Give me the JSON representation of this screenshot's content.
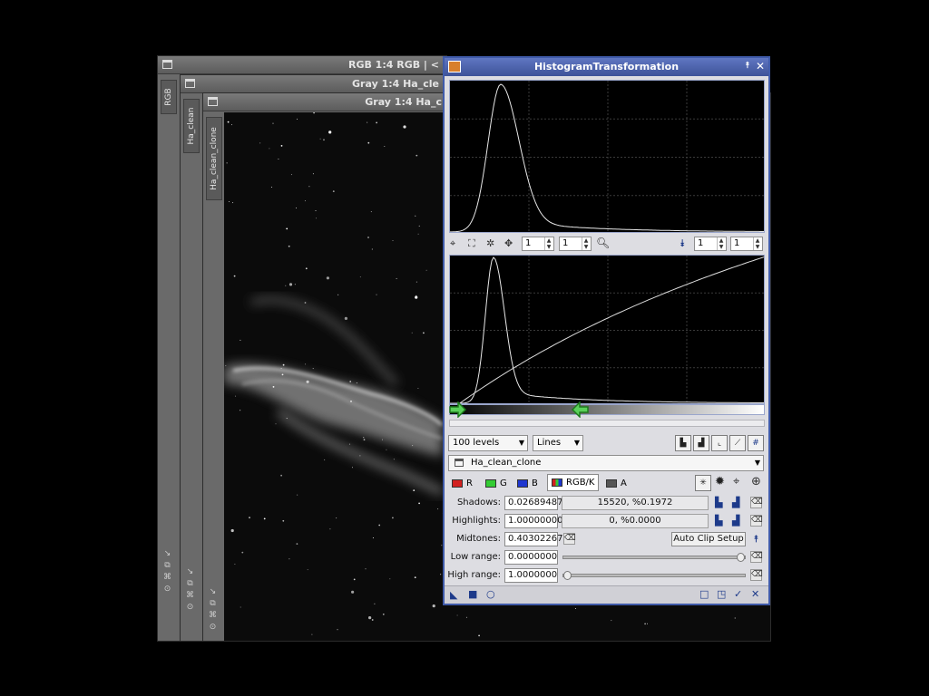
{
  "windows": [
    {
      "id": "rgb",
      "title": "RGB 1:4 RGB | <",
      "tab": "RGB"
    },
    {
      "id": "ha",
      "title": "Gray 1:4 Ha_cle",
      "tab": "Ha_clean"
    },
    {
      "id": "clone",
      "title": "Gray 1:4 Ha_c",
      "tab": "Ha_clean_clone"
    }
  ],
  "side_icons": [
    "↘",
    "⧉",
    "⌘",
    "⊙"
  ],
  "histogram": {
    "title": "HistogramTransformation",
    "title_buttons": [
      "⯭",
      "✕"
    ],
    "upper_toolbar": {
      "zoom_h": "1",
      "zoom_v": "1",
      "zoom_h2": "1",
      "zoom_v2": "1"
    },
    "levels": "100 levels",
    "style": "Lines",
    "view": "Ha_clean_clone",
    "channels": [
      {
        "label": "R",
        "color": "#d22020"
      },
      {
        "label": "G",
        "color": "#33cc33"
      },
      {
        "label": "B",
        "color": "#1f37d0"
      },
      {
        "label": "RGB/K",
        "color": "#777777"
      },
      {
        "label": "A",
        "color": "#555555"
      }
    ],
    "shadows": {
      "label": "Shadows:",
      "value": "0.02689487",
      "clip": "15520, %0.1972"
    },
    "highlights": {
      "label": "Highlights:",
      "value": "1.00000000",
      "clip": "0, %0.0000"
    },
    "midtones": {
      "label": "Midtones:",
      "value": "0.40302267"
    },
    "auto_clip": "Auto Clip Setup",
    "low_range": {
      "label": "Low range:",
      "value": "0.0000000",
      "position": 1.0
    },
    "high_range": {
      "label": "High range:",
      "value": "1.0000000",
      "position": 0.0
    },
    "curve_params": {
      "shadows": 0.0269,
      "midtones": 0.403,
      "peak": 0.16
    }
  }
}
